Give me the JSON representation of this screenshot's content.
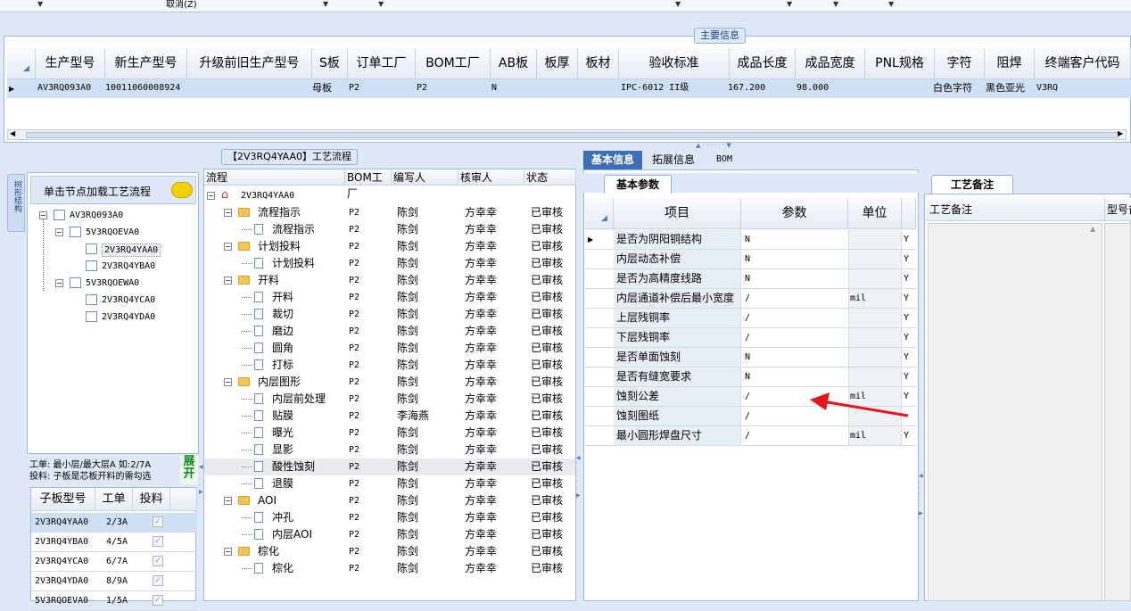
{
  "topbar": {
    "cancel_label": "取消(Z)"
  },
  "main_info": {
    "title": "主要信息",
    "columns": [
      "生产型号",
      "新生产型号",
      "升级前旧生产型号",
      "S板",
      "订单工厂",
      "BOM工厂",
      "AB板",
      "板厚",
      "板材",
      "验收标准",
      "成品长度",
      "成品宽度",
      "PNL规格",
      "字符",
      "阻焊",
      "终端客户代码"
    ],
    "row": {
      "model": "AV3RQ093A0",
      "new_model": "10011060008924",
      "s_board": "母板",
      "order_factory": "P2",
      "bom_factory": "P2",
      "ab_board": "N",
      "standard": "IPC-6012 II级",
      "length": "167.200",
      "width": "98.000",
      "char": "白色字符",
      "solder": "黑色亚光",
      "customer": "V3RQ"
    }
  },
  "process_title": "【2V3RQ4YAA0】工艺流程",
  "left": {
    "vtab": "树形结构",
    "load_button": "单击节点加载工艺流程",
    "tree": [
      {
        "label": "AV3RQ093A0",
        "level": 0
      },
      {
        "label": "5V3RQOEVA0",
        "level": 1
      },
      {
        "label": "2V3RQ4YAA0",
        "level": 2
      },
      {
        "label": "2V3RQ4YBA0",
        "level": 2
      },
      {
        "label": "5V3RQOEWA0",
        "level": 1
      },
      {
        "label": "2V3RQ4YCA0",
        "level": 2
      },
      {
        "label": "2V3RQ4YDA0",
        "level": 2
      }
    ],
    "note1": "工单: 最小层/最大层A 如:2/7A",
    "note2": "投料: 子板是芯板开料的需勾选",
    "expand_button": "展开",
    "sub_columns": [
      "子板型号",
      "工单",
      "投料"
    ],
    "sub_rows": [
      {
        "model": "2V3RQ4YAA0",
        "order": "2/3A"
      },
      {
        "model": "2V3RQ4YBA0",
        "order": "4/5A"
      },
      {
        "model": "2V3RQ4YCA0",
        "order": "6/7A"
      },
      {
        "model": "2V3RQ4YDA0",
        "order": "8/9A"
      },
      {
        "model": "5V3RQOEVA0",
        "order": "1/5A"
      }
    ]
  },
  "flow": {
    "columns": [
      "流程",
      "BOM工厂",
      "编写人",
      "核审人",
      "状态"
    ],
    "root": "2V3RQ4YAA0",
    "rows": [
      {
        "name": "流程指示",
        "type": "folder",
        "bom": "P2",
        "writer": "陈剑",
        "checker": "方幸幸",
        "status": "已审核"
      },
      {
        "name": "流程指示",
        "type": "doc",
        "bom": "P2",
        "writer": "陈剑",
        "checker": "方幸幸",
        "status": "已审核"
      },
      {
        "name": "计划投料",
        "type": "folder",
        "bom": "P2",
        "writer": "陈剑",
        "checker": "方幸幸",
        "status": "已审核"
      },
      {
        "name": "计划投料",
        "type": "doc",
        "bom": "P2",
        "writer": "陈剑",
        "checker": "方幸幸",
        "status": "已审核"
      },
      {
        "name": "开料",
        "type": "folder",
        "bom": "P2",
        "writer": "陈剑",
        "checker": "方幸幸",
        "status": "已审核"
      },
      {
        "name": "开料",
        "type": "doc",
        "bom": "P2",
        "writer": "陈剑",
        "checker": "方幸幸",
        "status": "已审核"
      },
      {
        "name": "裁切",
        "type": "doc",
        "bom": "P2",
        "writer": "陈剑",
        "checker": "方幸幸",
        "status": "已审核"
      },
      {
        "name": "磨边",
        "type": "doc",
        "bom": "P2",
        "writer": "陈剑",
        "checker": "方幸幸",
        "status": "已审核"
      },
      {
        "name": "圆角",
        "type": "doc",
        "bom": "P2",
        "writer": "陈剑",
        "checker": "方幸幸",
        "status": "已审核"
      },
      {
        "name": "打标",
        "type": "doc",
        "bom": "P2",
        "writer": "陈剑",
        "checker": "方幸幸",
        "status": "已审核"
      },
      {
        "name": "内层图形",
        "type": "folder",
        "bom": "P2",
        "writer": "陈剑",
        "checker": "方幸幸",
        "status": "已审核"
      },
      {
        "name": "内层前处理",
        "type": "doc",
        "bom": "P2",
        "writer": "陈剑",
        "checker": "方幸幸",
        "status": "已审核"
      },
      {
        "name": "贴膜",
        "type": "doc",
        "bom": "P2",
        "writer": "李海燕",
        "checker": "方幸幸",
        "status": "已审核"
      },
      {
        "name": "曝光",
        "type": "doc",
        "bom": "P2",
        "writer": "陈剑",
        "checker": "方幸幸",
        "status": "已审核"
      },
      {
        "name": "显影",
        "type": "doc",
        "bom": "P2",
        "writer": "陈剑",
        "checker": "方幸幸",
        "status": "已审核"
      },
      {
        "name": "酸性蚀刻",
        "type": "doc",
        "bom": "P2",
        "writer": "陈剑",
        "checker": "方幸幸",
        "status": "已审核"
      },
      {
        "name": "退膜",
        "type": "doc",
        "bom": "P2",
        "writer": "陈剑",
        "checker": "方幸幸",
        "status": "已审核"
      },
      {
        "name": "AOI",
        "type": "folder",
        "bom": "P2",
        "writer": "陈剑",
        "checker": "方幸幸",
        "status": "已审核"
      },
      {
        "name": "冲孔",
        "type": "doc",
        "bom": "P2",
        "writer": "陈剑",
        "checker": "方幸幸",
        "status": "已审核"
      },
      {
        "name": "内层AOI",
        "type": "doc",
        "bom": "P2",
        "writer": "陈剑",
        "checker": "方幸幸",
        "status": "已审核"
      },
      {
        "name": "棕化",
        "type": "folder",
        "bom": "P2",
        "writer": "陈剑",
        "checker": "方幸幸",
        "status": "已审核"
      },
      {
        "name": "棕化",
        "type": "doc",
        "bom": "P2",
        "writer": "陈剑",
        "checker": "方幸幸",
        "status": "已审核"
      }
    ]
  },
  "right": {
    "tabs": [
      "基本信息",
      "拓展信息",
      "BOM"
    ],
    "subtab": "基本参数",
    "columns": [
      "项目",
      "参数",
      "单位"
    ],
    "rows": [
      {
        "item": "是否为阴阳铜结构",
        "param": "N",
        "unit": "",
        "flag": "Y"
      },
      {
        "item": "内层动态补偿",
        "param": "N",
        "unit": "",
        "flag": "Y"
      },
      {
        "item": "是否为高精度线路",
        "param": "N",
        "unit": "",
        "flag": "Y"
      },
      {
        "item": "内层通道补偿后最小宽度",
        "param": "/",
        "unit": "mil",
        "flag": "Y"
      },
      {
        "item": "上层残铜率",
        "param": "/",
        "unit": "",
        "flag": "Y"
      },
      {
        "item": "下层残铜率",
        "param": "/",
        "unit": "",
        "flag": "Y"
      },
      {
        "item": "是否单面蚀刻",
        "param": "N",
        "unit": "",
        "flag": "Y"
      },
      {
        "item": "是否有缝宽要求",
        "param": "N",
        "unit": "",
        "flag": "Y"
      },
      {
        "item": "蚀刻公差",
        "param": "/",
        "unit": "mil",
        "flag": "Y"
      },
      {
        "item": "蚀刻图纸",
        "param": "/",
        "unit": "",
        "flag": ""
      },
      {
        "item": "最小圆形焊盘尺寸",
        "param": "/",
        "unit": "mil",
        "flag": "Y"
      }
    ],
    "remark_tab": "工艺备注",
    "remark_col": "工艺备注",
    "remark_col2": "型号备"
  },
  "colors": {
    "annotation_arrow": "#e8141b",
    "selected_row": "#cfe0f5",
    "header_blue": "#15428b"
  }
}
